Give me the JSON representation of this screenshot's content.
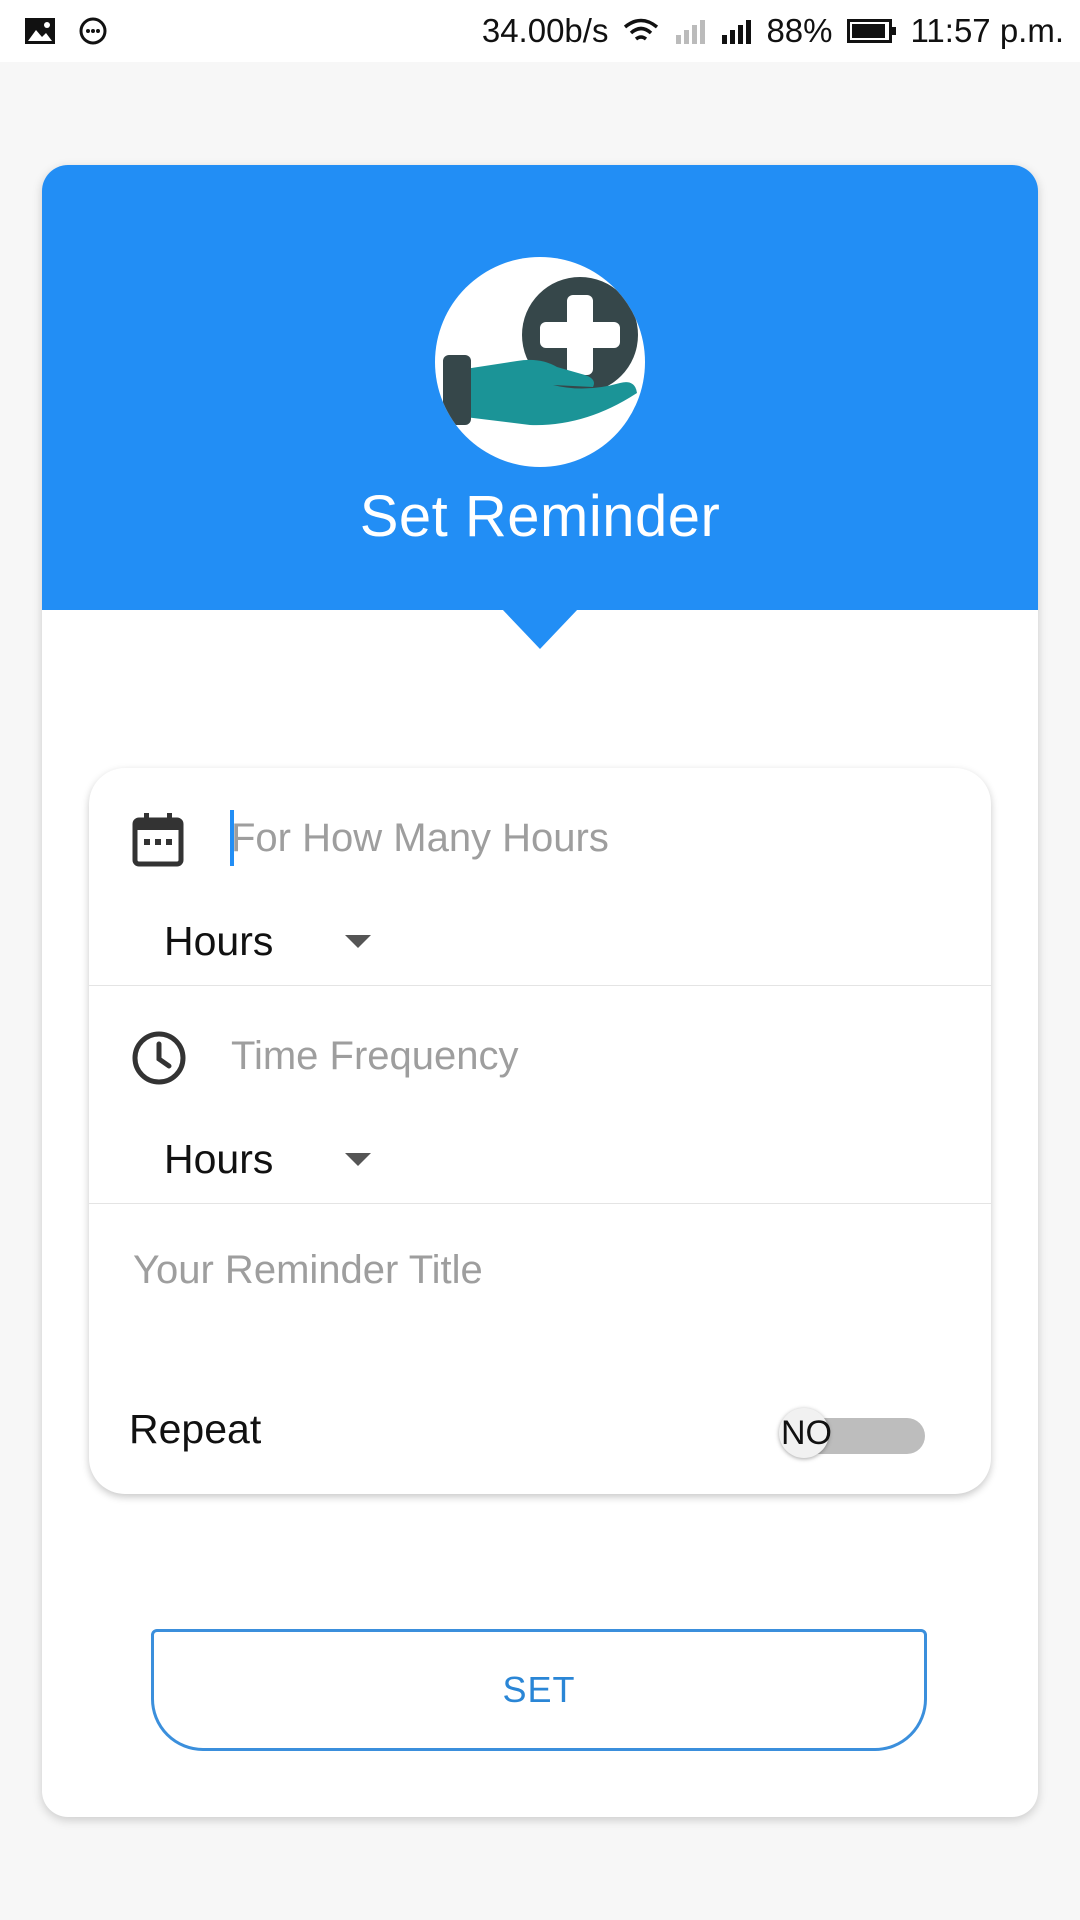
{
  "status_bar": {
    "network_speed": "34.00b/s",
    "battery_percent": "88%",
    "time": "11:57 p.m.",
    "icons": [
      "image-icon",
      "chat-icon",
      "wifi-icon",
      "signal-icon",
      "battery-icon"
    ]
  },
  "header": {
    "title": "Set Reminder",
    "background_color": "#228ef5",
    "logo_icon": "hand-medical-cross-icon"
  },
  "form": {
    "duration": {
      "placeholder": "For How Many Hours",
      "unit_value": "Hours",
      "icon": "calendar-icon"
    },
    "frequency": {
      "placeholder": "Time Frequency",
      "unit_value": "Hours",
      "icon": "clock-icon"
    },
    "title": {
      "placeholder": "Your Reminder Title"
    },
    "repeat": {
      "label": "Repeat",
      "toggle_text": "NO",
      "enabled": false
    }
  },
  "actions": {
    "set_label": "SET",
    "accent_color": "#2a86d6"
  }
}
